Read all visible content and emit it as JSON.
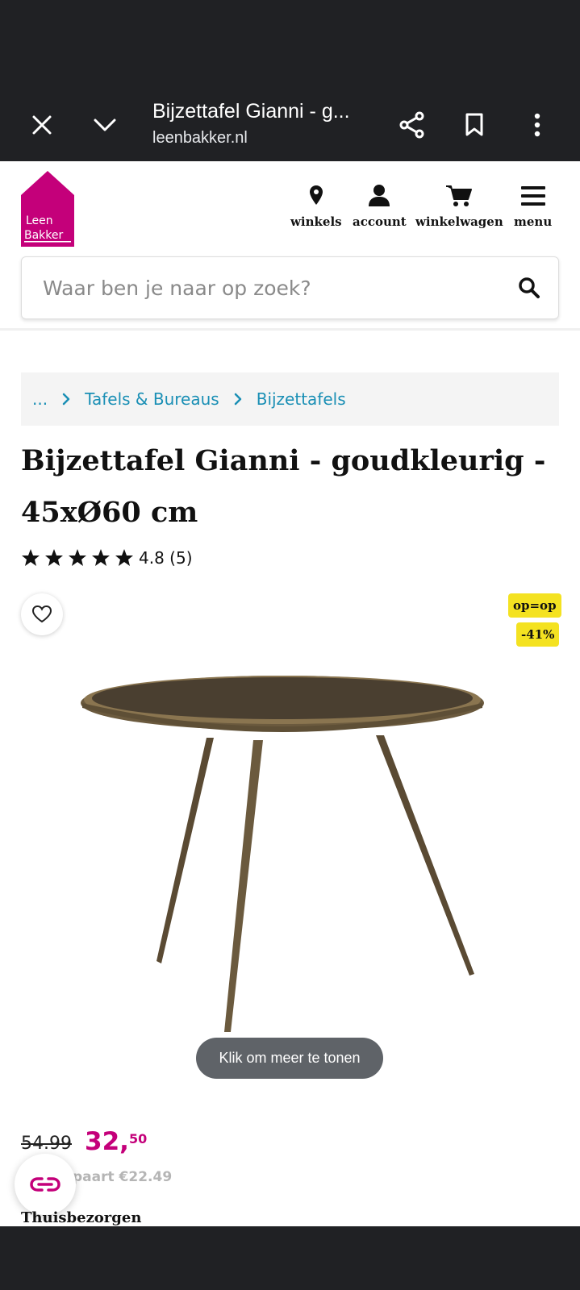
{
  "browser": {
    "tab_title": "Bijzettafel Gianni - g...",
    "url": "leenbakker.nl"
  },
  "site": {
    "logo_line1": "Leen",
    "logo_line2": "Bakker",
    "brand_color": "#c4007a",
    "nav": [
      {
        "label": "winkels",
        "icon": "location-pin-icon"
      },
      {
        "label": "account",
        "icon": "user-icon"
      },
      {
        "label": "winkelwagen",
        "icon": "cart-icon"
      },
      {
        "label": "menu",
        "icon": "hamburger-icon"
      }
    ],
    "search_placeholder": "Waar ben je naar op zoek?"
  },
  "breadcrumb": {
    "ellipsis": "...",
    "items": [
      "Tafels & Bureaus",
      "Bijzettafels"
    ]
  },
  "product": {
    "title": "Bijzettafel Gianni - goudkleurig - 45xØ60 cm",
    "rating": 4.8,
    "rating_text": "4.8 (5)",
    "stars": 5,
    "badges": [
      "op=op",
      "-41%"
    ],
    "badge_color": "#f4e221",
    "image_tooltip": "Klik om meer te tonen",
    "old_price": "54.99",
    "new_price_whole": "32,",
    "new_price_cents": "50",
    "savings": "paart €22.49",
    "delivery": "Thuisbezorgen"
  }
}
